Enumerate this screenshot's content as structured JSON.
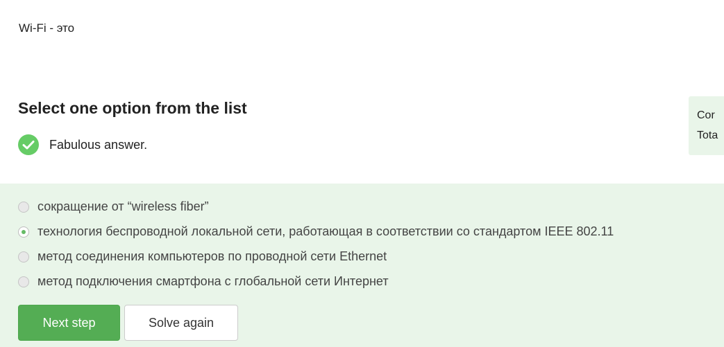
{
  "question": {
    "text": "Wi-Fi - это"
  },
  "instruction": "Select one option from the list",
  "feedback": {
    "icon": "checkmark-circle-icon",
    "text": "Fabulous answer.",
    "color": "#66cc66"
  },
  "side_panel": {
    "line1": "Cor",
    "line2": "Tota"
  },
  "options": [
    {
      "label": "сокращение от “wireless fiber”",
      "selected": false
    },
    {
      "label": "технология беспроводной локальной сети, работающая в соответствии со стандартом IEEE 802.11",
      "selected": true
    },
    {
      "label": "метод соединения компьютеров по проводной сети Ethernet",
      "selected": false
    },
    {
      "label": "метод подключения смартфона с глобальной сети Интернет",
      "selected": false
    }
  ],
  "buttons": {
    "next_label": "Next step",
    "solve_again_label": "Solve again"
  },
  "colors": {
    "accent_green": "#54ad54",
    "correct_background": "#e9f5e9"
  }
}
